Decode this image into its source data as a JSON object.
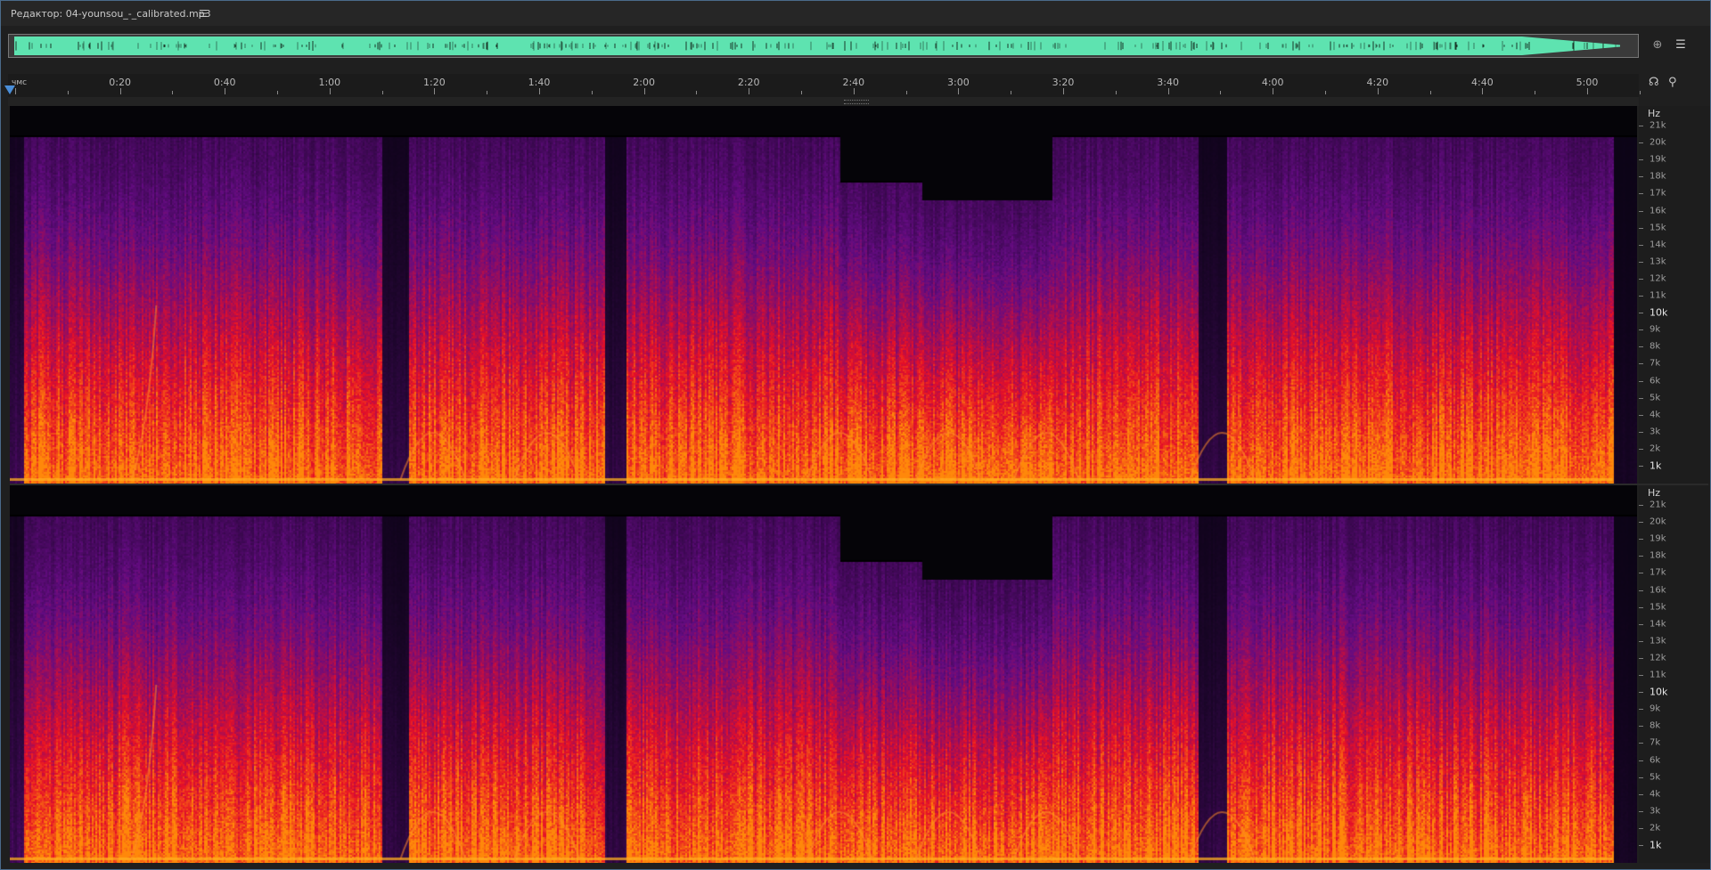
{
  "window": {
    "title": "Редактор: 04-younsou_-_calibrated.mp3",
    "menu_icon": "hamburger-menu-icon"
  },
  "overview": {
    "waveform_color": "#5ee3b0",
    "zoom_icon": "zoom-selection-icon",
    "view_icon": "waveform-view-icon"
  },
  "ruler": {
    "unit_label": "чмс",
    "ticks": [
      "0:20",
      "0:40",
      "1:00",
      "1:20",
      "1:40",
      "2:00",
      "2:20",
      "2:40",
      "3:00",
      "3:20",
      "3:40",
      "4:00",
      "4:20",
      "4:40",
      "5:00"
    ],
    "icons": [
      "headphones-icon",
      "marker-pin-icon"
    ]
  },
  "spectrogram": {
    "frequency_axis": {
      "unit": "Hz",
      "labels": [
        "21k",
        "20k",
        "19k",
        "18k",
        "17k",
        "16k",
        "15k",
        "14k",
        "13k",
        "12k",
        "11k",
        "10k",
        "9k",
        "8k",
        "7k",
        "6k",
        "5k",
        "4k",
        "3k",
        "2k",
        "1k"
      ],
      "highlighted": [
        "10k",
        "1k"
      ]
    },
    "colors": {
      "low": "#050408",
      "mid": "#6a1a8a",
      "high": "#e8141e",
      "peak": "#ffb020"
    }
  }
}
